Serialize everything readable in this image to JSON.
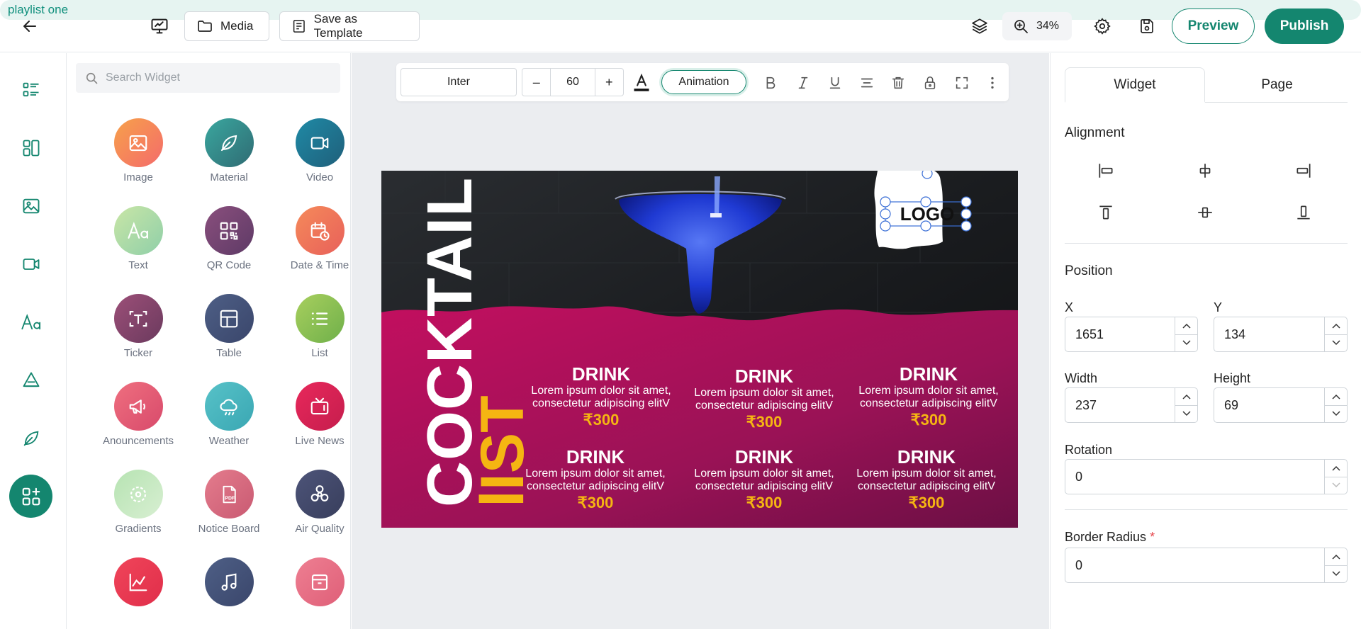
{
  "header": {
    "playlist_name": "playlist one",
    "media_label": "Media",
    "template_label": "Save as Template",
    "zoom": "34%",
    "preview_label": "Preview",
    "publish_label": "Publish",
    "accent_color": "#14866f"
  },
  "search": {
    "placeholder": "Search Widget"
  },
  "widgets": [
    {
      "label": "Image",
      "icon": "image-icon"
    },
    {
      "label": "Material",
      "icon": "leaf-icon"
    },
    {
      "label": "Video",
      "icon": "video-icon"
    },
    {
      "label": "Text",
      "icon": "text-icon"
    },
    {
      "label": "QR Code",
      "icon": "qr-icon"
    },
    {
      "label": "Date & Time",
      "icon": "calendar-clock-icon"
    },
    {
      "label": "Ticker",
      "icon": "ticker-icon"
    },
    {
      "label": "Table",
      "icon": "table-icon"
    },
    {
      "label": "List",
      "icon": "list-icon"
    },
    {
      "label": "Anouncements",
      "icon": "megaphone-icon"
    },
    {
      "label": "Weather",
      "icon": "cloud-icon"
    },
    {
      "label": "Live News",
      "icon": "tv-icon"
    },
    {
      "label": "Gradients",
      "icon": "gradient-icon"
    },
    {
      "label": "Notice Board",
      "icon": "pdf-icon"
    },
    {
      "label": "Air Quality",
      "icon": "fan-icon"
    }
  ],
  "toolbar": {
    "font": "Inter",
    "size_minus": "–",
    "size": "60",
    "size_plus": "+",
    "animation_label": "Animation"
  },
  "design": {
    "title": "COCKTAIL",
    "subtitle": "lIST",
    "logo": "LOGO",
    "items": [
      {
        "name": "DRINK",
        "desc1": "Lorem ipsum dolor sit amet,",
        "desc2": "consectetur adipiscing elitV",
        "price": "₹300"
      },
      {
        "name": "DRINK",
        "desc1": "Lorem ipsum dolor sit amet,",
        "desc2": "consectetur adipiscing elitV",
        "price": "₹300"
      },
      {
        "name": "DRINK",
        "desc1": "Lorem ipsum dolor sit amet,",
        "desc2": "consectetur adipiscing elitV",
        "price": "₹300"
      },
      {
        "name": "DRINK",
        "desc1": "Lorem ipsum dolor sit amet,",
        "desc2": "consectetur adipiscing elitV",
        "price": "₹300"
      },
      {
        "name": "DRINK",
        "desc1": "Lorem ipsum dolor sit amet,",
        "desc2": "consectetur adipiscing elitV",
        "price": "₹300"
      },
      {
        "name": "DRINK",
        "desc1": "Lorem ipsum dolor sit amet,",
        "desc2": "consectetur adipiscing elitV",
        "price": "₹300"
      }
    ],
    "price_color": "#f5b512",
    "bg_color": "#b3105c"
  },
  "props": {
    "tab_widget": "Widget",
    "tab_page": "Page",
    "alignment_label": "Alignment",
    "position_label": "Position",
    "x_label": "X",
    "x_value": "1651",
    "y_label": "Y",
    "y_value": "134",
    "width_label": "Width",
    "width_value": "237",
    "height_label": "Height",
    "height_value": "69",
    "rotation_label": "Rotation",
    "rotation_value": "0",
    "radius_label": "Border Radius",
    "radius_required": "*",
    "radius_value": "0"
  }
}
